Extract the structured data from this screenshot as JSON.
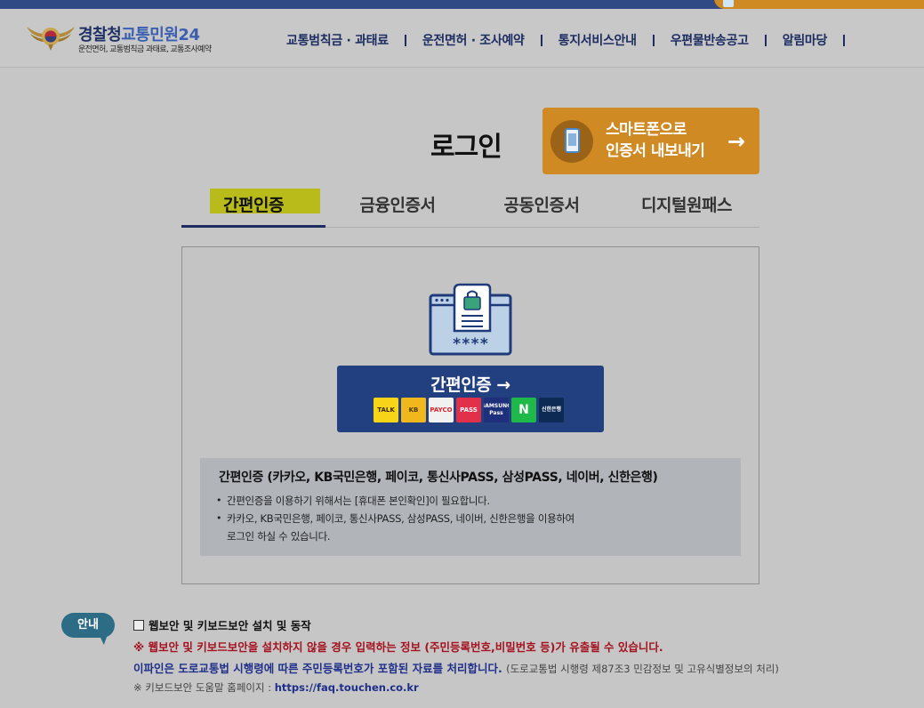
{
  "header": {
    "logo_title_main": "경찰청",
    "logo_title_accent": "교통민원24",
    "logo_subtitle": "운전면허, 교통범칙금 과태료, 교통조사예약",
    "nav": [
      {
        "label": "교통범칙금 · 과태료"
      },
      {
        "label": "운전면허 · 조사예약"
      },
      {
        "label": "통지서비스안내"
      },
      {
        "label": "우편물반송공고"
      },
      {
        "label": "알림마당"
      }
    ]
  },
  "page": {
    "title": "로그인",
    "export_button": {
      "line1": "스마트폰으로",
      "line2": "인증서 내보내기",
      "arrow": "→"
    }
  },
  "tabs": [
    {
      "label": "간편인증",
      "active": true
    },
    {
      "label": "금융인증서"
    },
    {
      "label": "공동인증서"
    },
    {
      "label": "디지털원패스"
    }
  ],
  "panel": {
    "cert_masked": "****",
    "easy_button_label": "간편인증 →",
    "providers": [
      {
        "name": "카카오",
        "text": "TALK",
        "bg": "#f7d417",
        "fg": "#3a2a00"
      },
      {
        "name": "KB국민은행",
        "text": "KB",
        "bg": "#f0b81c",
        "fg": "#4a3a10"
      },
      {
        "name": "페이코",
        "text": "PAYCO",
        "bg": "#f1f1f1",
        "fg": "#d8232a"
      },
      {
        "name": "통신사PASS",
        "text": "PASS",
        "bg": "#e0304a",
        "fg": "#ffffff"
      },
      {
        "name": "삼성PASS",
        "text": "SAMSUNG Pass",
        "bg": "#1e2f7c",
        "fg": "#ffffff"
      },
      {
        "name": "네이버",
        "text": "N",
        "bg": "#1fb94a",
        "fg": "#ffffff"
      },
      {
        "name": "신한은행",
        "text": "신한은행",
        "bg": "#0d2a55",
        "fg": "#ffffff"
      }
    ],
    "info_title": "간편인증 (카카오, KB국민은행, 페이코, 통신사PASS, 삼성PASS, 네이버, 신한은행)",
    "info_items": [
      "간편인증을 이용하기 위해서는 [휴대폰 본인확인]이 필요합니다.",
      "카카오, KB국민은행, 페이코, 통신사PASS, 삼성PASS, 네이버, 신한은행을 이용하여"
    ],
    "info_item_cont": "로그인 하실 수 있습니다."
  },
  "notice": {
    "badge": "안내",
    "checkbox_label": "웹보안 및 키보드보안 설치 및 동작",
    "warning": "※ 웹보안 및 키보드보안을 설치하지 않을 경우 입력하는 정보 (주민등록번호,비밀번호 등)가 유출될 수 있습니다.",
    "privacy_main": "이파인은 도로교통법 시행령에 따른 주민등록번호가 포함된 자료를 처리합니다.",
    "privacy_ref": "(도로교통법 시행령 제87조3 민감정보 및 고유식별정보의 처리)",
    "help_prefix": "※ 키보드보안 도움말 홈페이지 :",
    "help_link": "https://faq.touchen.co.kr"
  }
}
